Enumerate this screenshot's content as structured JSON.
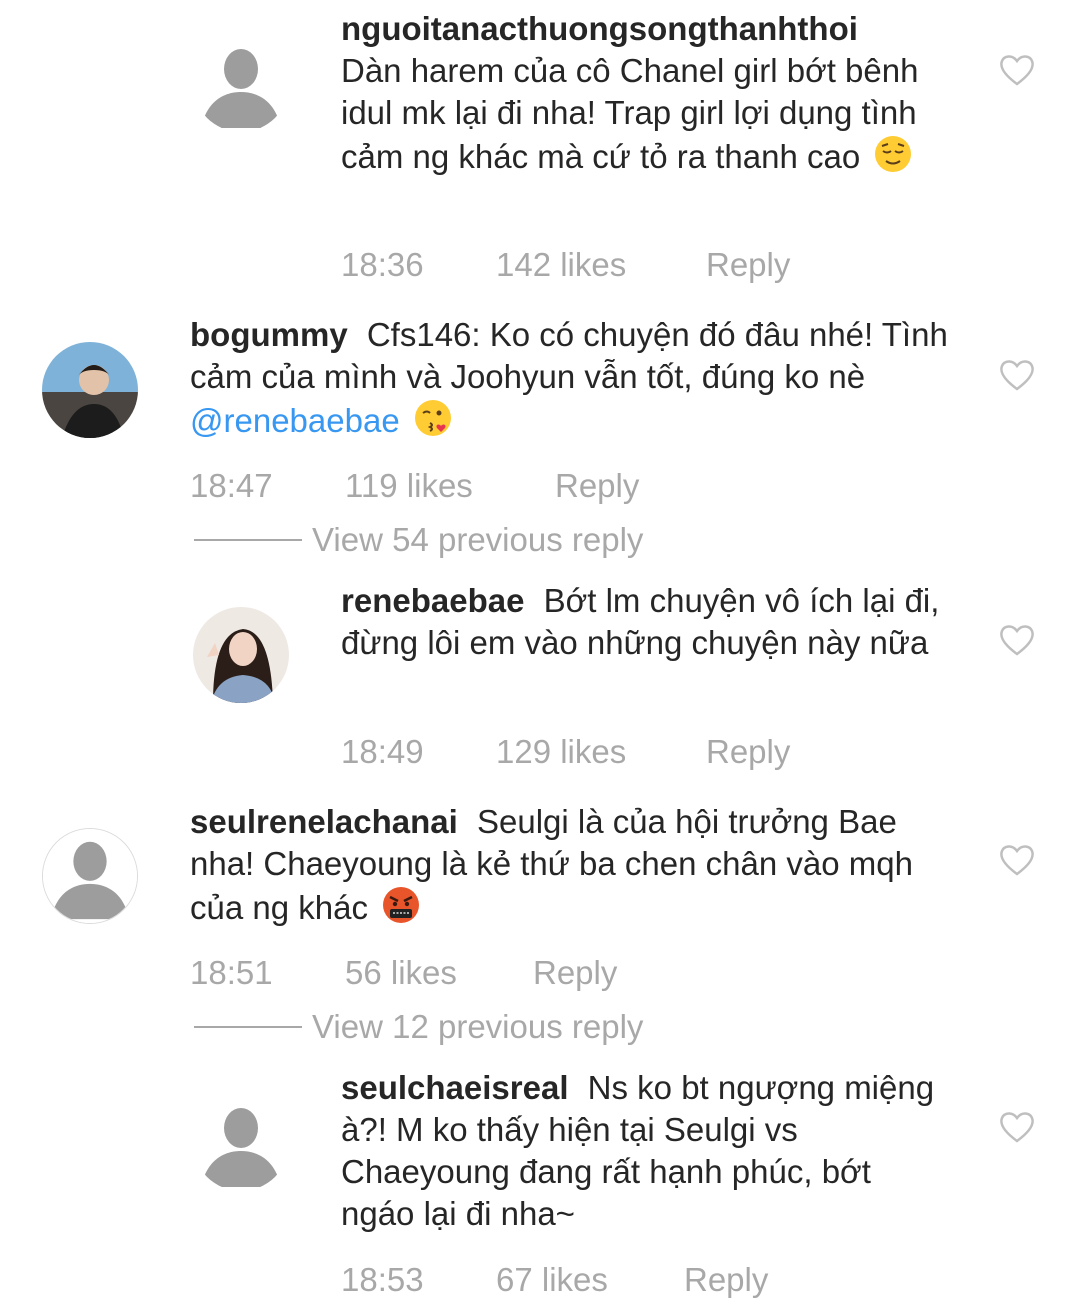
{
  "colors": {
    "text": "#262626",
    "muted": "#a8a8a8",
    "link": "#3897f0",
    "background": "#ffffff"
  },
  "comments": [
    {
      "username": "nguoitanacthuongsongthanhthoi",
      "text": "Dàn harem của cô Chanel girl bớt bênh idul mk lại đi nha! Trap girl lợi dụng tình cảm ng khác mà cứ tỏ ra thanh cao",
      "emoji": "relieved-face",
      "time": "18:36",
      "likes": "142 likes",
      "reply": "Reply",
      "avatar": "default-avatar-icon"
    },
    {
      "username": "bogummy",
      "text": "Cfs146: Ko có chuyện đó đâu nhé! Tình cảm của mình và Joohyun vẫn tốt, đúng ko nè",
      "mention": "@renebaebae",
      "emoji": "face-blowing-kiss",
      "time": "18:47",
      "likes": "119 likes",
      "reply": "Reply",
      "avatar": "profile-photo"
    },
    {
      "username": "renebaebae",
      "text": "Bớt lm chuyện vô ích lại đi, đừng lôi em vào những chuyện này nữa",
      "time": "18:49",
      "likes": "129 likes",
      "reply": "Reply",
      "avatar": "profile-photo"
    },
    {
      "username": "seulrenelachanai",
      "text": "Seulgi là của hội trưởng Bae nha! Chaeyoung là kẻ thứ ba chen chân vào mqh của ng khác",
      "emoji": "face-with-symbols-on-mouth",
      "time": "18:51",
      "likes": "56 likes",
      "reply": "Reply",
      "avatar": "default-avatar-icon"
    },
    {
      "username": "seulchaeisreal",
      "text": "Ns ko bt ngượng miệng à?! M ko thấy hiện tại Seulgi vs Chaeyoung đang rất hạnh phúc, bớt ngáo lại đi nha~",
      "time": "18:53",
      "likes": "67 likes",
      "reply": "Reply",
      "avatar": "default-avatar-icon"
    }
  ],
  "view_previous": [
    {
      "label": "View 54 previous reply"
    },
    {
      "label": "View 12 previous reply"
    }
  ]
}
